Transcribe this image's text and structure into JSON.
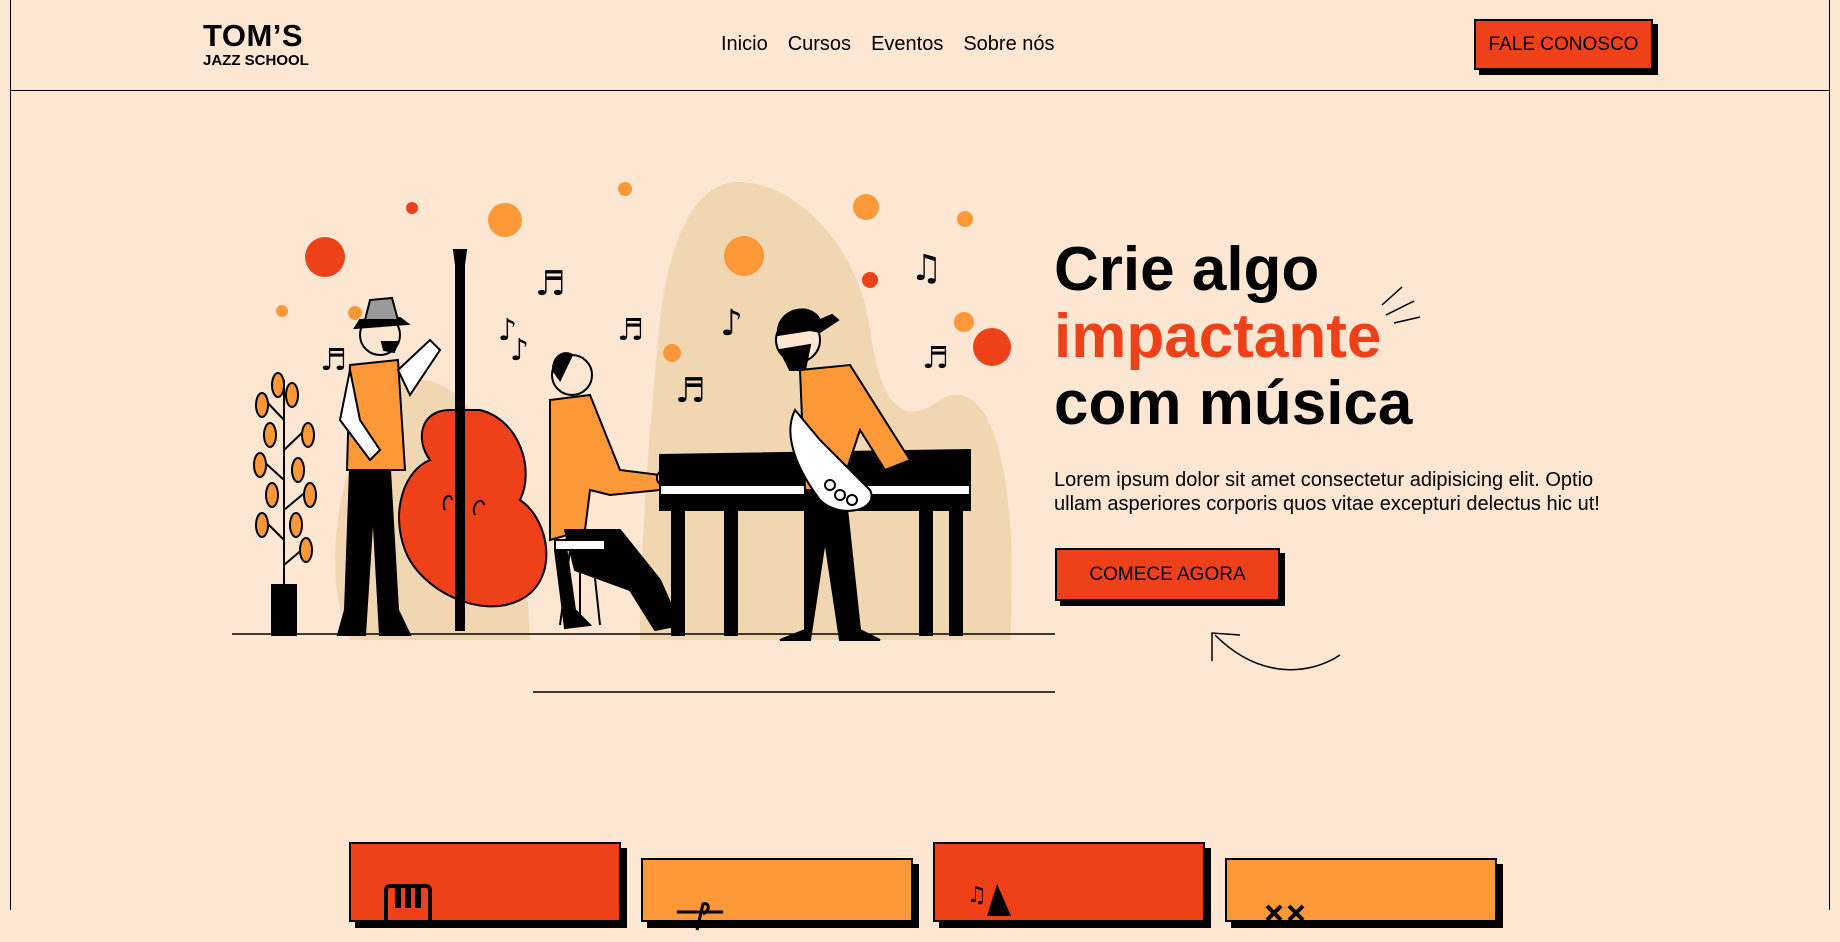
{
  "brand": {
    "line1": "TOM’S",
    "line2": "JAZZ SCHOOL"
  },
  "nav": {
    "items": [
      "Inicio",
      "Cursos",
      "Eventos",
      "Sobre nós"
    ]
  },
  "header": {
    "contact_label": "FALE CONOSCO"
  },
  "hero": {
    "title_line1": "Crie algo",
    "title_accent": "impactante",
    "title_line3": "com música",
    "text": "Lorem ipsum dolor sit amet consectetur adipisicing elit. Optio ullam asperiores corporis quos vitae excepturi delectus hic ut!",
    "cta_label": "COMECE AGORA"
  },
  "cards": [
    {
      "icon": "piano-keys-icon",
      "color": "#ee4119"
    },
    {
      "icon": "music-staff-icon",
      "color": "#fd9839"
    },
    {
      "icon": "saxophone-icon",
      "color": "#ee4119"
    },
    {
      "icon": "cymbals-icon",
      "color": "#fd9839"
    }
  ],
  "colors": {
    "background": "#fee7d2",
    "accent_red": "#ee4119",
    "accent_orange": "#fd9839",
    "blob": "#f0d7b1"
  }
}
